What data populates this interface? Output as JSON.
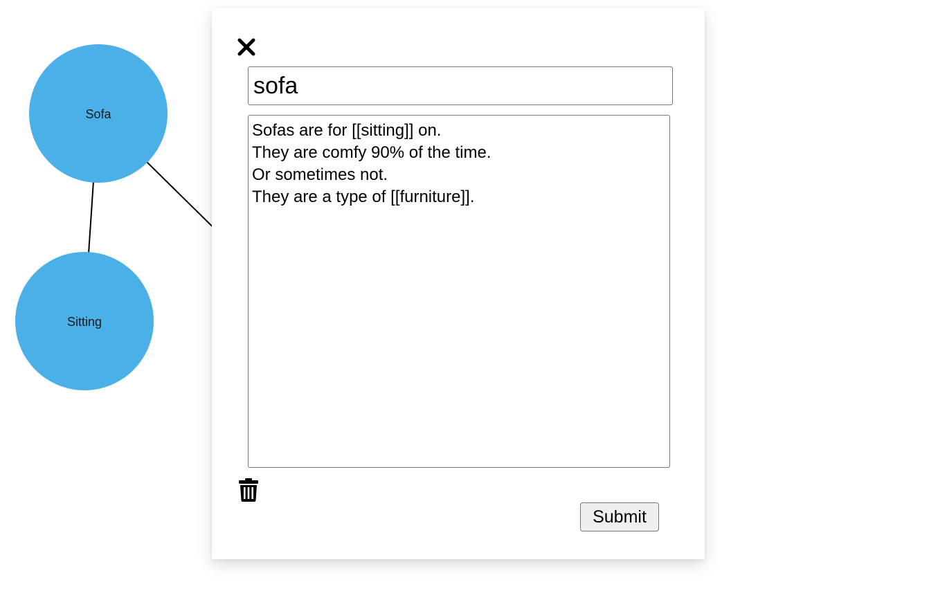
{
  "graph": {
    "node_color": "#4bb0e8",
    "nodes": [
      {
        "id": "sofa",
        "label": "Sofa"
      },
      {
        "id": "sitting",
        "label": "Sitting"
      }
    ]
  },
  "editor": {
    "close_icon": "close-icon",
    "title_value": "sofa",
    "body_value": "Sofas are for [[sitting]] on.\nThey are comfy 90% of the time.\nOr sometimes not.\nThey are a type of [[furniture]].",
    "delete_icon": "trash-icon",
    "submit_label": "Submit"
  }
}
